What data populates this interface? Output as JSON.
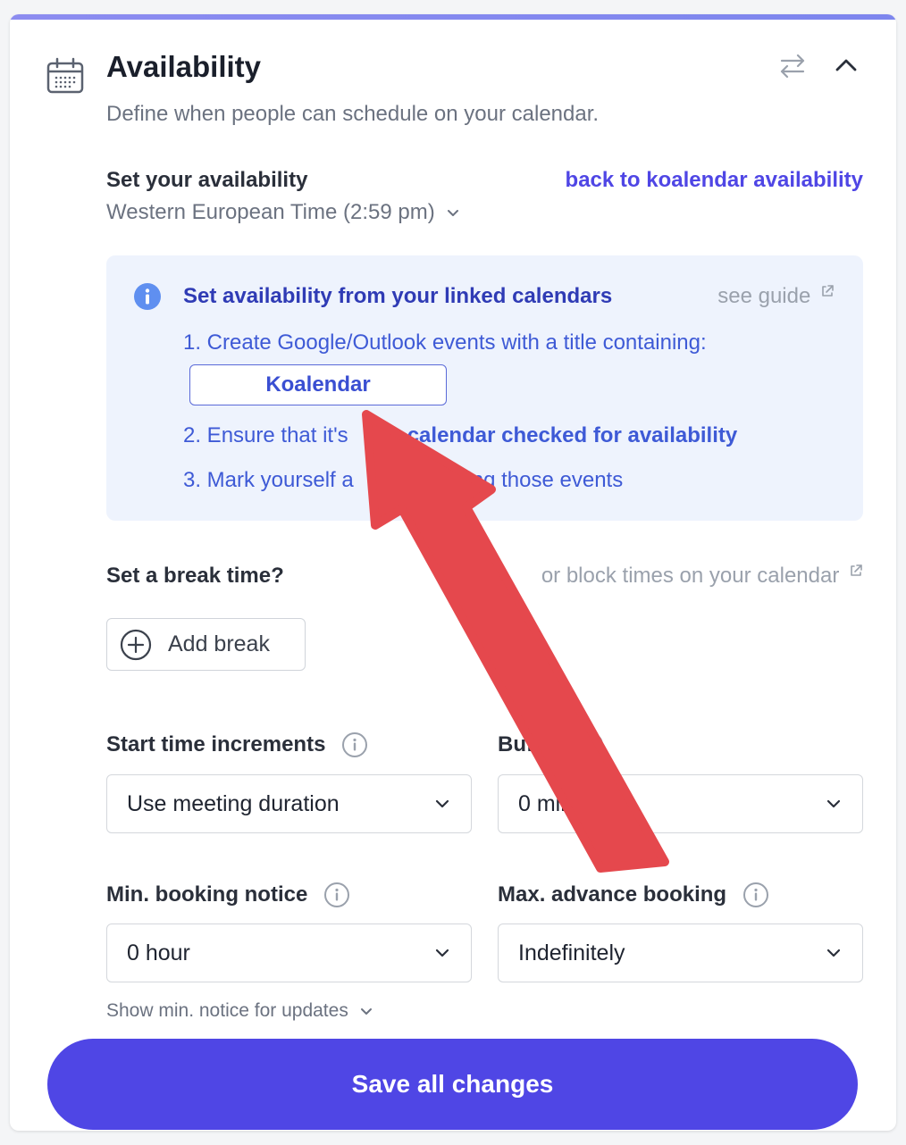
{
  "header": {
    "title": "Availability",
    "subtitle": "Define when people can schedule on your calendar."
  },
  "availability": {
    "label": "Set your availability",
    "back_link": "back to koalendar availability",
    "timezone": "Western European Time (2:59 pm)"
  },
  "info_box": {
    "title": "Set availability from your linked calendars",
    "guide_link": "see guide",
    "step1": "1. Create Google/Outlook events with a title containing:",
    "keyword": "Koalendar",
    "step2_prefix": "2. Ensure that it's",
    "step2_bold": "a calendar checked for availability",
    "step3_prefix": "3. Mark yourself a",
    "step3_suffix": "during those events"
  },
  "break": {
    "label": "Set a break time?",
    "block_link": "or block times on your calendar",
    "add_button": "Add break"
  },
  "fields": {
    "start_increments": {
      "label": "Start time increments",
      "value": "Use meeting duration"
    },
    "buffer": {
      "label": "Buffer",
      "value": "0 min"
    },
    "min_notice": {
      "label": "Min. booking notice",
      "value": "0 hour"
    },
    "max_advance": {
      "label": "Max. advance booking",
      "value": "Indefinitely"
    }
  },
  "show_min_notice": "Show min. notice for updates",
  "save_button": "Save all changes",
  "colors": {
    "accent": "#4f46e5",
    "info_bg": "#eef3fd",
    "annotation_arrow": "#e5484d"
  }
}
